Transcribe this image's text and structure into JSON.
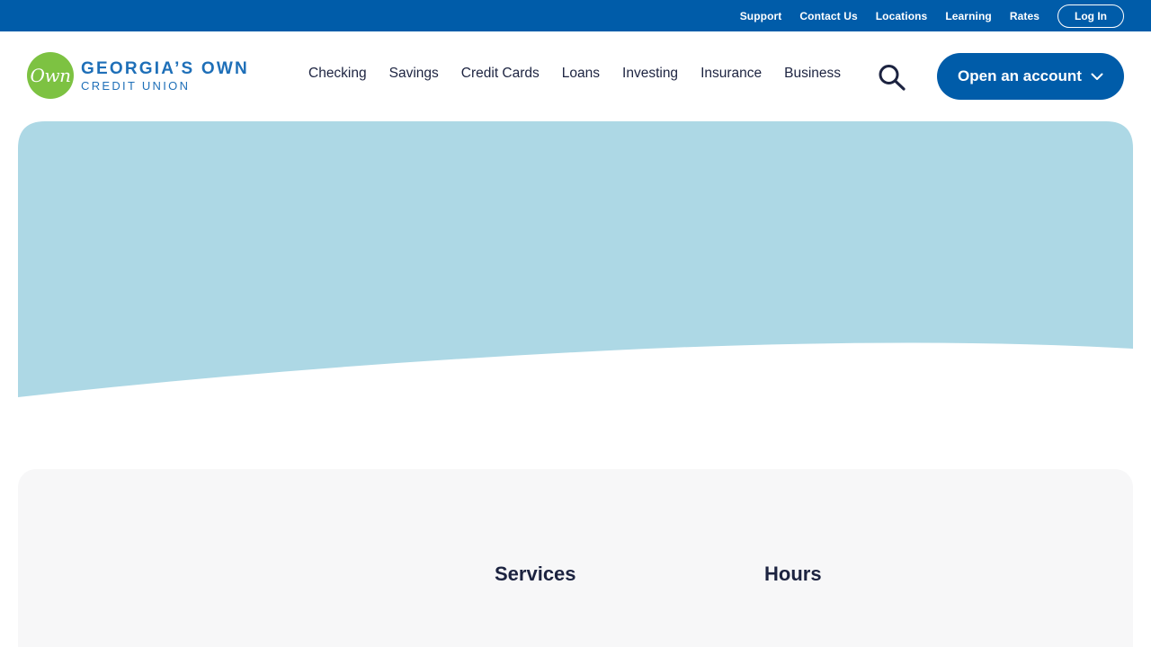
{
  "colors": {
    "brand_blue": "#005ca9",
    "logo_green": "#7dc242",
    "logo_text_blue": "#1e6fb8",
    "hero_blue": "#add8e5",
    "card_gray": "#f7f7f8",
    "text_dark": "#1c2340"
  },
  "utility_bar": {
    "links": [
      "Support",
      "Contact Us",
      "Locations",
      "Learning",
      "Rates"
    ],
    "login_label": "Log In"
  },
  "logo": {
    "mark_text": "Own",
    "line1": "GEORGIA’S OWN",
    "line2": "CREDIT UNION"
  },
  "nav": {
    "items": [
      "Checking",
      "Savings",
      "Credit Cards",
      "Loans",
      "Investing",
      "Insurance",
      "Business"
    ],
    "search_icon": "search-icon",
    "cta_label": "Open an account",
    "cta_icon": "chevron-down-icon"
  },
  "info": {
    "services_heading": "Services",
    "hours_heading": "Hours"
  }
}
